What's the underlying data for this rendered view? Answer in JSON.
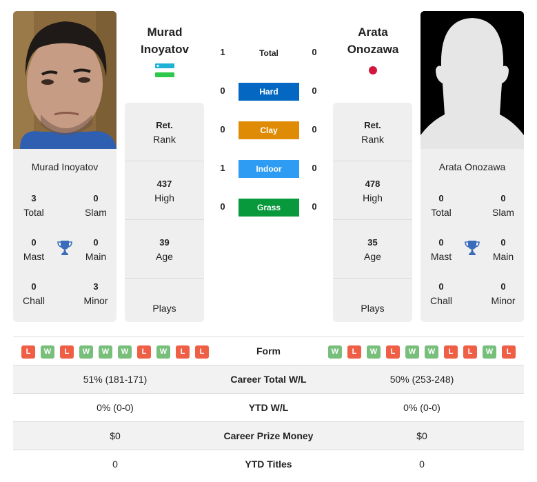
{
  "colors": {
    "hard": "#0468c2",
    "clay": "#e08b06",
    "indoor": "#2e9cf2",
    "grass": "#07993b",
    "win": "#79bf7c",
    "loss": "#ee5f46",
    "trophy": "#3a6cbb"
  },
  "player1": {
    "name_line1": "Murad",
    "name_line2": "Inoyatov",
    "full_name": "Murad Inoyatov",
    "flag": "uzbekistan-flag",
    "titles": {
      "total": {
        "value": "3",
        "label": "Total"
      },
      "slam": {
        "value": "0",
        "label": "Slam"
      },
      "mast": {
        "value": "0",
        "label": "Mast"
      },
      "main": {
        "value": "0",
        "label": "Main"
      },
      "chall": {
        "value": "0",
        "label": "Chall"
      },
      "minor": {
        "value": "3",
        "label": "Minor"
      }
    },
    "rank": {
      "value": "Ret.",
      "label": "Rank"
    },
    "high": {
      "value": "437",
      "label": "High"
    },
    "age": {
      "value": "39",
      "label": "Age"
    },
    "plays": {
      "label": "Plays"
    },
    "form": [
      "L",
      "W",
      "L",
      "W",
      "W",
      "W",
      "L",
      "W",
      "L",
      "L"
    ],
    "career_wl": "51% (181-171)",
    "ytd_wl": "0% (0-0)",
    "prize": "$0",
    "ytd_titles": "0"
  },
  "player2": {
    "name_line1": "Arata",
    "name_line2": "Onozawa",
    "full_name": "Arata Onozawa",
    "flag": "japan-flag",
    "titles": {
      "total": {
        "value": "0",
        "label": "Total"
      },
      "slam": {
        "value": "0",
        "label": "Slam"
      },
      "mast": {
        "value": "0",
        "label": "Mast"
      },
      "main": {
        "value": "0",
        "label": "Main"
      },
      "chall": {
        "value": "0",
        "label": "Chall"
      },
      "minor": {
        "value": "0",
        "label": "Minor"
      }
    },
    "rank": {
      "value": "Ret.",
      "label": "Rank"
    },
    "high": {
      "value": "478",
      "label": "High"
    },
    "age": {
      "value": "35",
      "label": "Age"
    },
    "plays": {
      "label": "Plays"
    },
    "form": [
      "W",
      "L",
      "W",
      "L",
      "W",
      "W",
      "L",
      "L",
      "W",
      "L"
    ],
    "career_wl": "50% (253-248)",
    "ytd_wl": "0% (0-0)",
    "prize": "$0",
    "ytd_titles": "0"
  },
  "h2h": [
    {
      "label": "Total",
      "left": "1",
      "right": "0"
    },
    {
      "label": "Hard",
      "left": "0",
      "right": "0"
    },
    {
      "label": "Clay",
      "left": "0",
      "right": "0"
    },
    {
      "label": "Indoor",
      "left": "1",
      "right": "0"
    },
    {
      "label": "Grass",
      "left": "0",
      "right": "0"
    }
  ],
  "table_labels": {
    "form": "Form",
    "career_wl": "Career Total W/L",
    "ytd_wl": "YTD W/L",
    "prize": "Career Prize Money",
    "ytd_titles": "YTD Titles"
  }
}
